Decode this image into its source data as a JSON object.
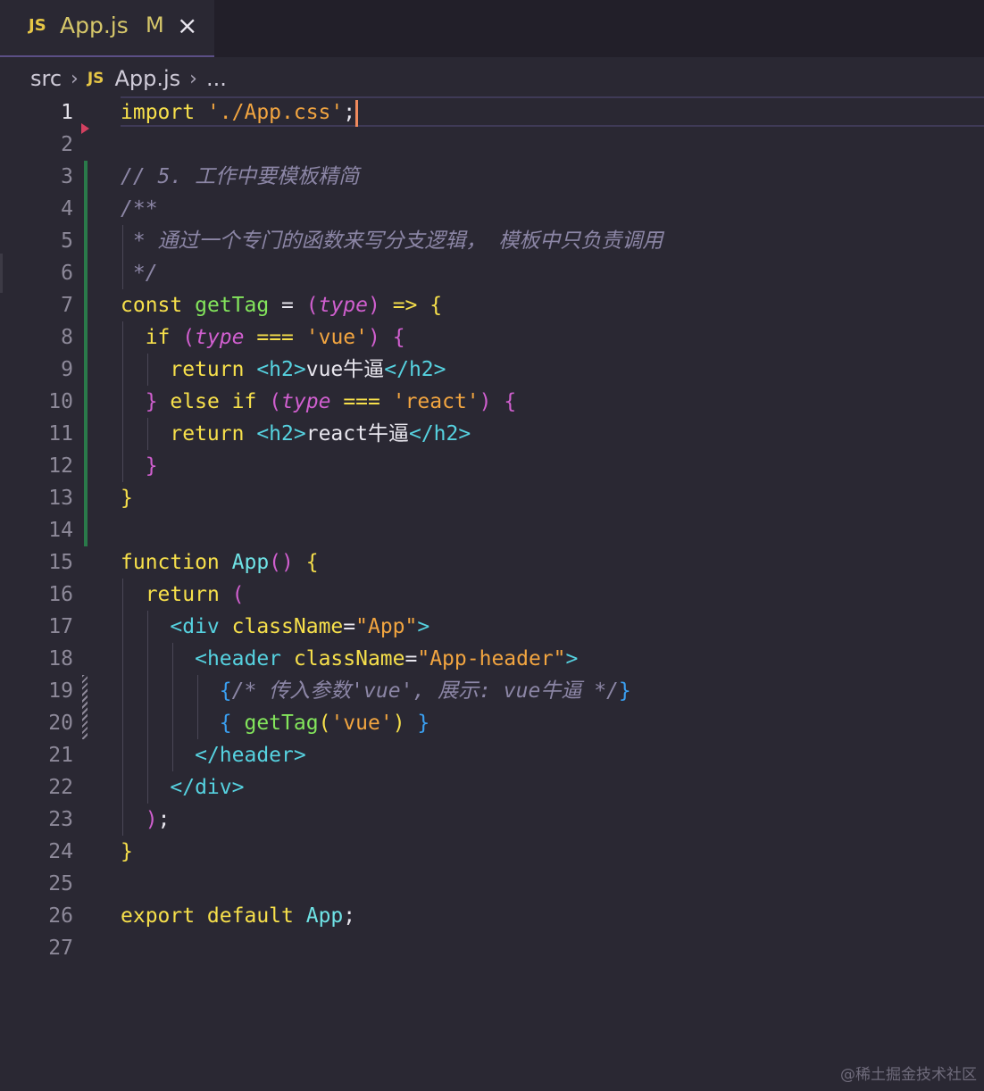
{
  "tab": {
    "icon": "JS",
    "filename": "App.js",
    "status": "M",
    "close": "×"
  },
  "breadcrumb": {
    "folder": "src",
    "icon": "JS",
    "file": "App.js",
    "more": "..."
  },
  "watermark": "@稀土掘金技术社区",
  "colors": {
    "background": "#2a2833",
    "keyword": "#f7e04b",
    "string": "#f2a540",
    "comment": "#8c86a6",
    "function": "#83e55c",
    "tag": "#56d2e0"
  },
  "lines": [
    {
      "n": "1",
      "t": [
        [
          "kw",
          "import "
        ],
        [
          "str",
          "'./App.css'"
        ],
        [
          "txt",
          ";"
        ]
      ]
    },
    {
      "n": "2",
      "t": []
    },
    {
      "n": "3",
      "t": [
        [
          "cm",
          "// 5. 工作中要模板精简"
        ]
      ]
    },
    {
      "n": "4",
      "t": [
        [
          "cm",
          "/**"
        ]
      ]
    },
    {
      "n": "5",
      "t": [
        [
          "cm",
          " * 通过一个专门的函数来写分支逻辑， 模板中只负责调用"
        ]
      ]
    },
    {
      "n": "6",
      "t": [
        [
          "cm",
          " */"
        ]
      ]
    },
    {
      "n": "7",
      "t": [
        [
          "kw",
          "const "
        ],
        [
          "fn",
          "getTag"
        ],
        [
          "txt",
          " = "
        ],
        [
          "par",
          "("
        ],
        [
          "ital",
          "type"
        ],
        [
          "par",
          ")"
        ],
        [
          "txt",
          " "
        ],
        [
          "kw",
          "=>"
        ],
        [
          "txt",
          " "
        ],
        [
          "brace",
          "{"
        ]
      ]
    },
    {
      "n": "8",
      "t": [
        [
          "txt",
          "  "
        ],
        [
          "kw",
          "if "
        ],
        [
          "par",
          "("
        ],
        [
          "ital",
          "type"
        ],
        [
          "txt",
          " "
        ],
        [
          "kw",
          "==="
        ],
        [
          "txt",
          " "
        ],
        [
          "str",
          "'vue'"
        ],
        [
          "par",
          ")"
        ],
        [
          "txt",
          " "
        ],
        [
          "brace2",
          "{"
        ]
      ]
    },
    {
      "n": "9",
      "t": [
        [
          "txt",
          "    "
        ],
        [
          "kw",
          "return "
        ],
        [
          "tag",
          "<h2>"
        ],
        [
          "txt",
          "vue牛逼"
        ],
        [
          "tag",
          "</h2>"
        ]
      ]
    },
    {
      "n": "10",
      "t": [
        [
          "txt",
          "  "
        ],
        [
          "brace2",
          "}"
        ],
        [
          "txt",
          " "
        ],
        [
          "kw",
          "else if "
        ],
        [
          "par",
          "("
        ],
        [
          "ital",
          "type"
        ],
        [
          "txt",
          " "
        ],
        [
          "kw",
          "==="
        ],
        [
          "txt",
          " "
        ],
        [
          "str",
          "'react'"
        ],
        [
          "par",
          ")"
        ],
        [
          "txt",
          " "
        ],
        [
          "brace2",
          "{"
        ]
      ]
    },
    {
      "n": "11",
      "t": [
        [
          "txt",
          "    "
        ],
        [
          "kw",
          "return "
        ],
        [
          "tag",
          "<h2>"
        ],
        [
          "txt",
          "react牛逼"
        ],
        [
          "tag",
          "</h2>"
        ]
      ]
    },
    {
      "n": "12",
      "t": [
        [
          "txt",
          "  "
        ],
        [
          "brace2",
          "}"
        ]
      ]
    },
    {
      "n": "13",
      "t": [
        [
          "brace",
          "}"
        ]
      ]
    },
    {
      "n": "14",
      "t": []
    },
    {
      "n": "15",
      "t": [
        [
          "kw",
          "function "
        ],
        [
          "nm",
          "App"
        ],
        [
          "par",
          "()"
        ],
        [
          "txt",
          " "
        ],
        [
          "brace",
          "{"
        ]
      ]
    },
    {
      "n": "16",
      "t": [
        [
          "txt",
          "  "
        ],
        [
          "kw",
          "return "
        ],
        [
          "par",
          "("
        ]
      ]
    },
    {
      "n": "17",
      "t": [
        [
          "txt",
          "    "
        ],
        [
          "tag",
          "<div "
        ],
        [
          "attr",
          "className"
        ],
        [
          "txt",
          "="
        ],
        [
          "str",
          "\"App\""
        ],
        [
          "tag",
          ">"
        ]
      ]
    },
    {
      "n": "18",
      "t": [
        [
          "txt",
          "      "
        ],
        [
          "tag",
          "<header "
        ],
        [
          "attr",
          "className"
        ],
        [
          "txt",
          "="
        ],
        [
          "str",
          "\"App-header\""
        ],
        [
          "tag",
          ">"
        ]
      ]
    },
    {
      "n": "19",
      "t": [
        [
          "txt",
          "        "
        ],
        [
          "brace3",
          "{"
        ],
        [
          "cm",
          "/* 传入参数'vue', 展示: vue牛逼 */"
        ],
        [
          "brace3",
          "}"
        ]
      ]
    },
    {
      "n": "20",
      "t": [
        [
          "txt",
          "        "
        ],
        [
          "brace3",
          "{ "
        ],
        [
          "fn",
          "getTag"
        ],
        [
          "brace",
          "("
        ],
        [
          "str",
          "'vue'"
        ],
        [
          "brace",
          ")"
        ],
        [
          "brace3",
          " }"
        ]
      ]
    },
    {
      "n": "21",
      "t": [
        [
          "txt",
          "      "
        ],
        [
          "tag",
          "</header>"
        ]
      ]
    },
    {
      "n": "22",
      "t": [
        [
          "txt",
          "    "
        ],
        [
          "tag",
          "</div>"
        ]
      ]
    },
    {
      "n": "23",
      "t": [
        [
          "txt",
          "  "
        ],
        [
          "par",
          ")"
        ],
        [
          "txt",
          ";"
        ]
      ]
    },
    {
      "n": "24",
      "t": [
        [
          "brace",
          "}"
        ]
      ]
    },
    {
      "n": "25",
      "t": []
    },
    {
      "n": "26",
      "t": [
        [
          "kw",
          "export default "
        ],
        [
          "nm",
          "App"
        ],
        [
          "txt",
          ";"
        ]
      ]
    },
    {
      "n": "27",
      "t": []
    }
  ]
}
